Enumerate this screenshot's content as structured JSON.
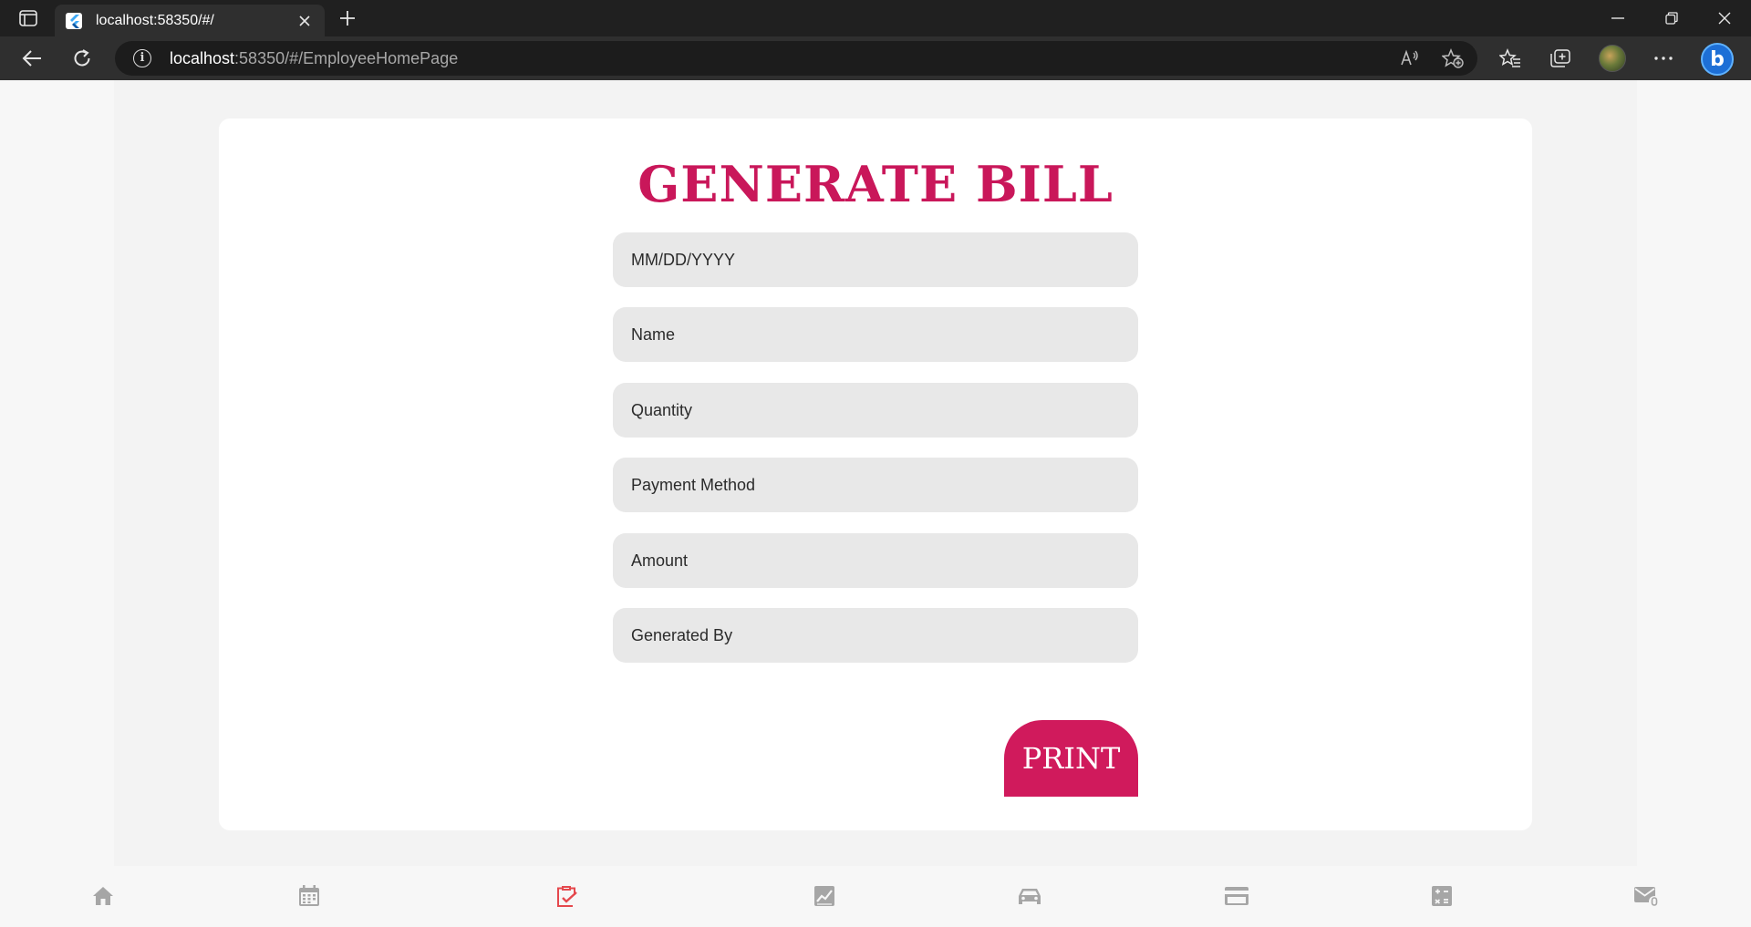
{
  "browser": {
    "tab_title": "localhost:58350/#/",
    "url_host": "localhost",
    "url_rest": ":58350/#/EmployeeHomePage"
  },
  "page": {
    "heading": "GENERATE BILL",
    "fields": {
      "date_placeholder": "MM/DD/YYYY",
      "name_placeholder": "Name",
      "quantity_placeholder": "Quantity",
      "payment_placeholder": "Payment Method",
      "amount_placeholder": "Amount",
      "generated_by_placeholder": "Generated By"
    },
    "print_label": "PRINT"
  },
  "nav": {
    "items": [
      "home-icon",
      "calendar-icon",
      "clipboard-check-icon",
      "chart-icon",
      "car-icon",
      "credit-card-icon",
      "calculator-icon",
      "mail-icon"
    ],
    "active": "clipboard-check-icon",
    "active_color": "#e5484d",
    "inactive_color": "#a6a6a6"
  },
  "colors": {
    "accent": "#d01a5c",
    "field_bg": "#e8e8e8"
  }
}
